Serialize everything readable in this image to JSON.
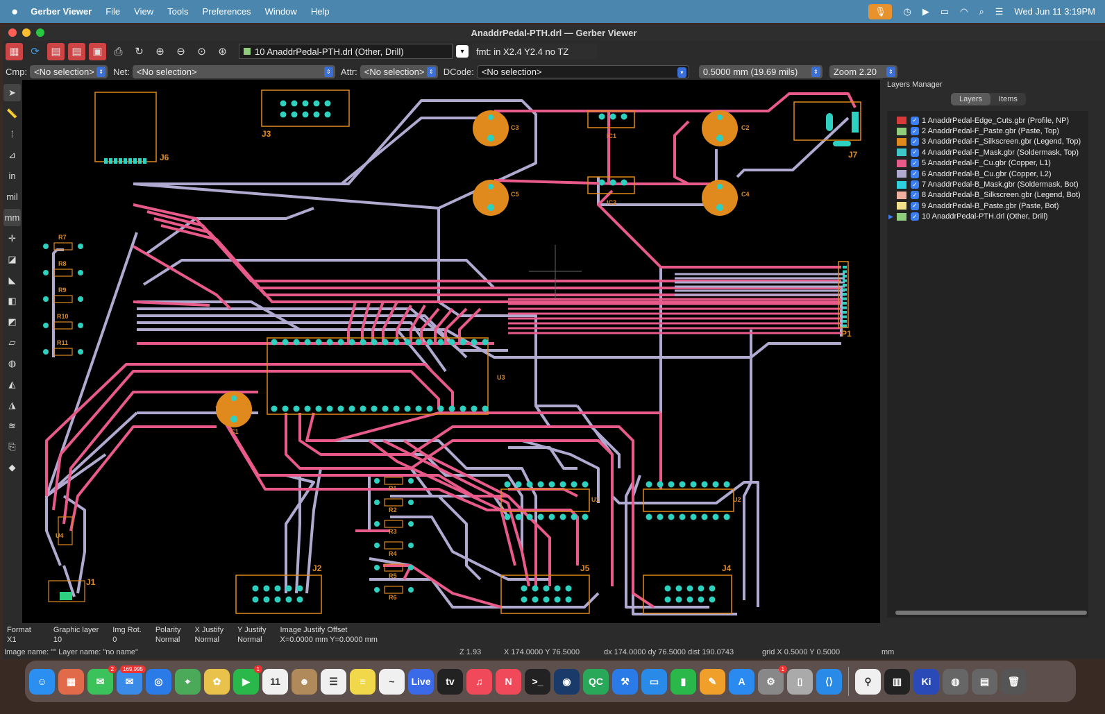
{
  "menubar": {
    "app": "Gerber Viewer",
    "items": [
      "File",
      "View",
      "Tools",
      "Preferences",
      "Window",
      "Help"
    ],
    "clock": "Wed Jun 11  3:19PM"
  },
  "window": {
    "title": "AnaddrPedal-PTH.drl — Gerber Viewer"
  },
  "toolbar": {
    "layer_select": "10 AnaddrPedal-PTH.drl (Other, Drill)",
    "fmt": "fmt: in X2.4 Y2.4 no TZ"
  },
  "selectbar": {
    "cmp_label": "Cmp:",
    "cmp_value": "<No selection>",
    "net_label": "Net:",
    "net_value": "<No selection>",
    "attr_label": "Attr:",
    "attr_value": "<No selection>",
    "dcode_label": "DCode:",
    "dcode_value": "<No selection>",
    "grid_value": "0.5000 mm (19.69 mils)",
    "zoom_value": "Zoom 2.20"
  },
  "lefttools": [
    "select-arrow",
    "ruler",
    "grid",
    "polar",
    "in",
    "mil",
    "mm",
    "cursor",
    "dcode",
    "flash",
    "negative",
    "sketch",
    "outline",
    "layer-color",
    "show-dcode",
    "layer-visible",
    "highlight",
    "net",
    "layers"
  ],
  "layers_manager": {
    "title": "Layers Manager",
    "tabs": [
      "Layers",
      "Items"
    ],
    "layers": [
      {
        "label": "1 AnaddrPedal-Edge_Cuts.gbr (Profile, NP)",
        "color": "#d63a3a"
      },
      {
        "label": "2 AnaddrPedal-F_Paste.gbr (Paste, Top)",
        "color": "#8fcc7c"
      },
      {
        "label": "3 AnaddrPedal-F_Silkscreen.gbr (Legend, Top)",
        "color": "#e08a1e"
      },
      {
        "label": "4 AnaddrPedal-F_Mask.gbr (Soldermask, Top)",
        "color": "#3ec6c8"
      },
      {
        "label": "5 AnaddrPedal-F_Cu.gbr (Copper, L1)",
        "color": "#e85a8a"
      },
      {
        "label": "6 AnaddrPedal-B_Cu.gbr (Copper, L2)",
        "color": "#b0aad0"
      },
      {
        "label": "7 AnaddrPedal-B_Mask.gbr (Soldermask, Bot)",
        "color": "#2ed0e0"
      },
      {
        "label": "8 AnaddrPedal-B_Silkscreen.gbr (Legend, Bot)",
        "color": "#f0b0a0"
      },
      {
        "label": "9 AnaddrPedal-B_Paste.gbr (Paste, Bot)",
        "color": "#f0e08a"
      },
      {
        "label": "10 AnaddrPedal-PTH.drl (Other, Drill)",
        "color": "#8fcc7c"
      }
    ]
  },
  "status": {
    "format_h": "Format",
    "format_v": "X1",
    "glayer_h": "Graphic layer",
    "glayer_v": "10",
    "imgrot_h": "Img Rot.",
    "imgrot_v": "0",
    "polarity_h": "Polarity",
    "polarity_v": "Normal",
    "xjust_h": "X Justify",
    "xjust_v": "Normal",
    "yjust_h": "Y Justify",
    "yjust_v": "Normal",
    "offset_h": "Image Justify Offset",
    "offset_v": "X=0.0000 mm Y=0.0000 mm",
    "image_name": "Image name: \"\"  Layer name: \"no name\"",
    "zoom": "Z 1.93",
    "xy": "X 174.0000  Y 76.5000",
    "dxy": "dx 174.0000  dy 76.5000  dist 190.0743",
    "grid": "grid X 0.5000  Y 0.5000",
    "units": "mm"
  },
  "pcb_labels": [
    "J3",
    "J6",
    "C3",
    "IC1",
    "C2",
    "J7",
    "C5",
    "IC2",
    "C4",
    "R7",
    "R8",
    "R9",
    "R10",
    "R11",
    "P1",
    "U3",
    "C1",
    "R1",
    "R2",
    "R3",
    "R4",
    "R5",
    "R6",
    "J2",
    "J5",
    "J4",
    "U4",
    "J1",
    "U1",
    "U2"
  ],
  "dock": [
    {
      "name": "finder",
      "color": "#2a8ff0",
      "glyph": "☺"
    },
    {
      "name": "launchpad",
      "color": "#e06a4a",
      "glyph": "▦"
    },
    {
      "name": "messages",
      "color": "#3cc25a",
      "glyph": "✉",
      "badge": "2"
    },
    {
      "name": "mail",
      "color": "#3a8ae8",
      "glyph": "✉",
      "badge": "169,995"
    },
    {
      "name": "safari",
      "color": "#2a7ae8",
      "glyph": "◎"
    },
    {
      "name": "maps",
      "color": "#4aaa5a",
      "glyph": "⌖"
    },
    {
      "name": "photos",
      "color": "#e8c24a",
      "glyph": "✿"
    },
    {
      "name": "facetime",
      "color": "#2ab84a",
      "glyph": "▶",
      "badge": "1"
    },
    {
      "name": "calendar",
      "color": "#f0f0f0",
      "glyph": "11"
    },
    {
      "name": "contacts",
      "color": "#b08a5a",
      "glyph": "☻"
    },
    {
      "name": "reminders",
      "color": "#f0f0f0",
      "glyph": "☰"
    },
    {
      "name": "notes",
      "color": "#f0d84a",
      "glyph": "≡"
    },
    {
      "name": "freeform",
      "color": "#f0f0f0",
      "glyph": "~"
    },
    {
      "name": "live",
      "color": "#3a6ae8",
      "glyph": "Live"
    },
    {
      "name": "tv",
      "color": "#222",
      "glyph": "tv"
    },
    {
      "name": "music",
      "color": "#f04a5a",
      "glyph": "♫"
    },
    {
      "name": "news",
      "color": "#f04a5a",
      "glyph": "N"
    },
    {
      "name": "terminal",
      "color": "#222",
      "glyph": ">_"
    },
    {
      "name": "steam",
      "color": "#1a3a6a",
      "glyph": "◉"
    },
    {
      "name": "qc",
      "color": "#2aa85a",
      "glyph": "QC"
    },
    {
      "name": "xcode",
      "color": "#2a7ae8",
      "glyph": "⚒"
    },
    {
      "name": "keynote",
      "color": "#2a8ae8",
      "glyph": "▭"
    },
    {
      "name": "numbers",
      "color": "#2ab84a",
      "glyph": "▮"
    },
    {
      "name": "pages",
      "color": "#f0a02a",
      "glyph": "✎"
    },
    {
      "name": "app-store",
      "color": "#2a8af0",
      "glyph": "A"
    },
    {
      "name": "system-settings",
      "color": "#888",
      "glyph": "⚙",
      "badge": "1"
    },
    {
      "name": "iphone-mirroring",
      "color": "#aaa",
      "glyph": "▯"
    },
    {
      "name": "vscode",
      "color": "#2a8ae8",
      "glyph": "⟨⟩"
    },
    {
      "name": "sep",
      "color": "",
      "glyph": ""
    },
    {
      "name": "kicad-icon",
      "color": "#f0f0f0",
      "glyph": "⚲"
    },
    {
      "name": "piano",
      "color": "#222",
      "glyph": "▥"
    },
    {
      "name": "kicad",
      "color": "#2a4ab8",
      "glyph": "Ki"
    },
    {
      "name": "disk-utility",
      "color": "#666",
      "glyph": "◍"
    },
    {
      "name": "stacks",
      "color": "#666",
      "glyph": "▤"
    },
    {
      "name": "trash",
      "color": "#555",
      "glyph": "🗑"
    }
  ]
}
